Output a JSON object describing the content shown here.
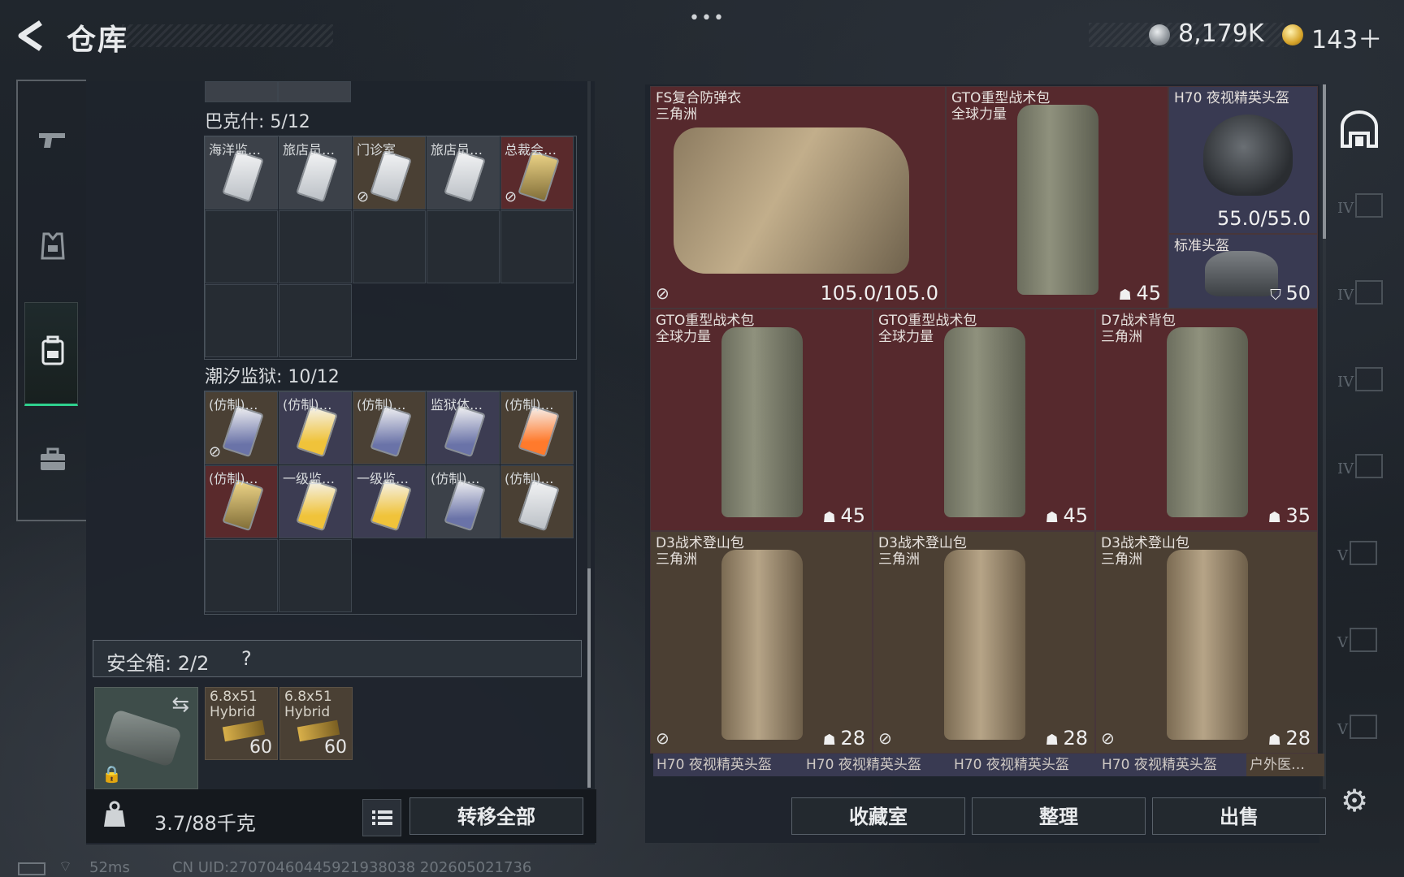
{
  "header": {
    "title": "仓库",
    "menu_dots": "•••",
    "currency": [
      {
        "icon": "silver-coin-icon",
        "value": "8,179K"
      },
      {
        "icon": "gold-coin-icon",
        "value": "143＋"
      }
    ]
  },
  "left_nav": {
    "items": [
      {
        "icon": "gun-icon"
      },
      {
        "icon": "armor-vest-icon"
      },
      {
        "icon": "backpack-icon",
        "active": true
      },
      {
        "icon": "briefcase-icon"
      }
    ]
  },
  "inventory": {
    "section1": {
      "title": "巴克什: 5/12",
      "items": [
        {
          "label": "海洋监…",
          "color": "gray",
          "card": "white"
        },
        {
          "label": "旅店员…",
          "color": "gray",
          "card": "white"
        },
        {
          "label": "门诊室",
          "color": "brown",
          "card": "white",
          "no_discard": true
        },
        {
          "label": "旅店员…",
          "color": "gray",
          "card": "white"
        },
        {
          "label": "总裁会…",
          "color": "red",
          "card": "gold",
          "no_discard": true
        }
      ]
    },
    "section2": {
      "title": "潮汐监狱: 10/12",
      "items": [
        {
          "label": "(仿制)…",
          "color": "brown",
          "card": "blue",
          "no_discard": true
        },
        {
          "label": "(仿制)…",
          "color": "purple",
          "card": "yellow"
        },
        {
          "label": "(仿制)…",
          "color": "brown",
          "card": "blue"
        },
        {
          "label": "监狱体…",
          "color": "purple",
          "card": "blue"
        },
        {
          "label": "(仿制)…",
          "color": "brown",
          "card": "orange"
        },
        {
          "label": "(仿制)…",
          "color": "red",
          "card": "gold"
        },
        {
          "label": "一级监…",
          "color": "purple",
          "card": "yellow"
        },
        {
          "label": "一级监…",
          "color": "purple",
          "card": "yellow"
        },
        {
          "label": "(仿制)…",
          "color": "gray",
          "card": "blue"
        },
        {
          "label": "(仿制)…",
          "color": "brown",
          "card": "white"
        }
      ]
    },
    "safe_box": {
      "label": "安全箱: 2/2",
      "help": "?"
    },
    "ammo": [
      {
        "name": "6.8x51 Hybrid",
        "qty": "60"
      },
      {
        "name": "6.8x51 Hybrid",
        "qty": "60"
      }
    ],
    "weight": "3.7/88千克",
    "transfer_all": "转移全部"
  },
  "stash": {
    "items": [
      {
        "name": "FS复合防弹衣",
        "sub": "三角洲",
        "value": "105.0/105.0",
        "color": "red",
        "no_discard": true
      },
      {
        "name": "GTO重型战术包",
        "sub": "全球力量",
        "value": "45",
        "value_icon": "backpack-capacity",
        "color": "red"
      },
      {
        "name": "H70 夜视精英头盔",
        "sub": "",
        "value": "55.0/55.0",
        "color": "purple"
      },
      {
        "name": "标准头盔",
        "sub": "",
        "value": "50",
        "value_icon": "shield",
        "color": "purple"
      },
      {
        "name": "GTO重型战术包",
        "sub": "全球力量",
        "value": "45",
        "color": "red"
      },
      {
        "name": "GTO重型战术包",
        "sub": "全球力量",
        "value": "45",
        "color": "red"
      },
      {
        "name": "D7战术背包",
        "sub": "三角洲",
        "value": "35",
        "color": "red"
      },
      {
        "name": "D3战术登山包",
        "sub": "三角洲",
        "value": "28",
        "color": "brown",
        "no_discard": true
      },
      {
        "name": "D3战术登山包",
        "sub": "三角洲",
        "value": "28",
        "color": "brown",
        "no_discard": true
      },
      {
        "name": "D3战术登山包",
        "sub": "三角洲",
        "value": "28",
        "color": "brown",
        "no_discard": true
      }
    ],
    "peek_row": [
      "H70 夜视精英头盔",
      "H70 夜视精英头盔",
      "H70 夜视精英头盔",
      "H70 夜视精英头盔",
      "户外医…"
    ]
  },
  "right_nav": {
    "tiers": [
      "IV",
      "IV",
      "IV",
      "IV",
      "V",
      "V",
      "V"
    ]
  },
  "actions": {
    "collection": "收藏室",
    "organize": "整理",
    "sell": "出售"
  },
  "footer": {
    "ping": "52ms",
    "uid": "CN UID:270704604459219380​38 202605021736"
  },
  "colors": {
    "accent_green": "#2fd18e",
    "item_red": "#56292d",
    "item_brown": "#4b3f33",
    "item_purple": "#393a52",
    "item_gray": "#3c4149"
  }
}
